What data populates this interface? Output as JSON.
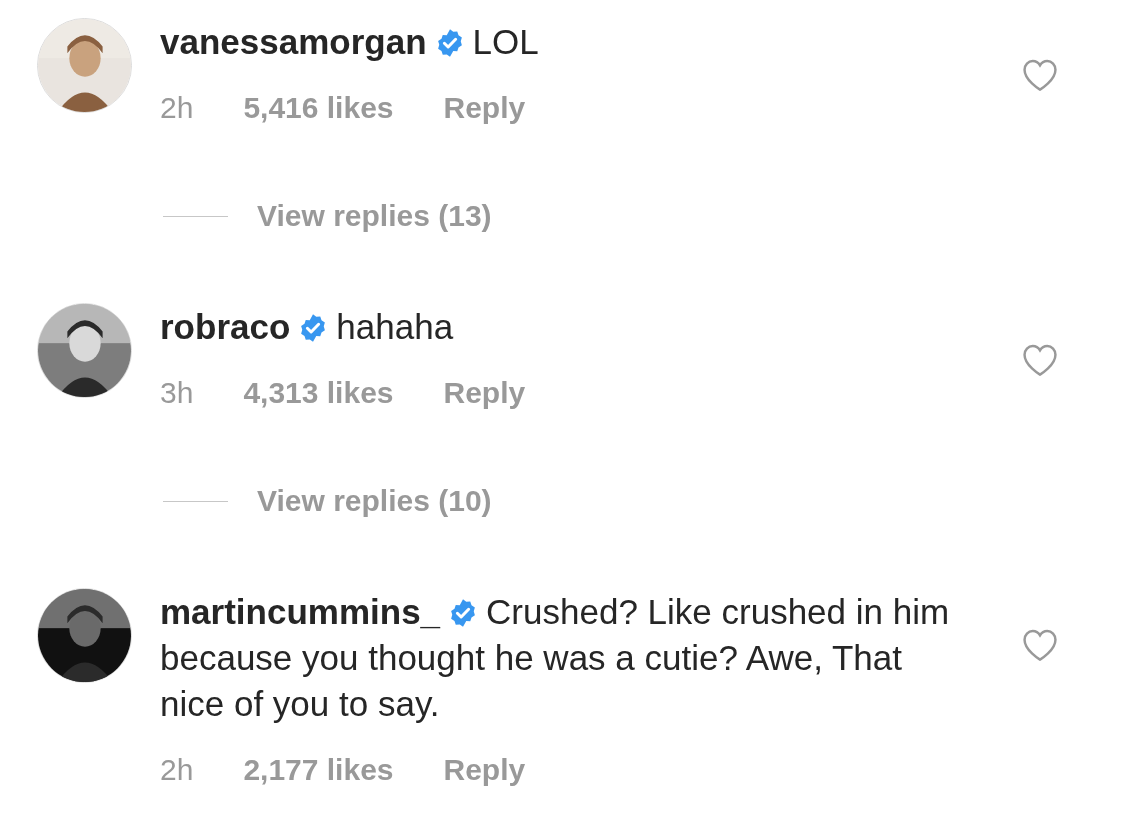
{
  "comments": [
    {
      "username": "vanessamorgan",
      "verified": true,
      "text": "LOL",
      "time": "2h",
      "likes": "5,416 likes",
      "reply": "Reply",
      "liked": false,
      "view_replies": "View replies (13)"
    },
    {
      "username": "robraco",
      "verified": true,
      "text": "hahaha",
      "time": "3h",
      "likes": "4,313 likes",
      "reply": "Reply",
      "liked": false,
      "view_replies": "View replies (10)"
    },
    {
      "username": "martincummins_",
      "verified": true,
      "text": "Crushed? Like crushed in him because you thought he was a cutie? Awe, That nice of you to say.",
      "time": "2h",
      "likes": "2,177 likes",
      "reply": "Reply",
      "liked": false
    }
  ]
}
